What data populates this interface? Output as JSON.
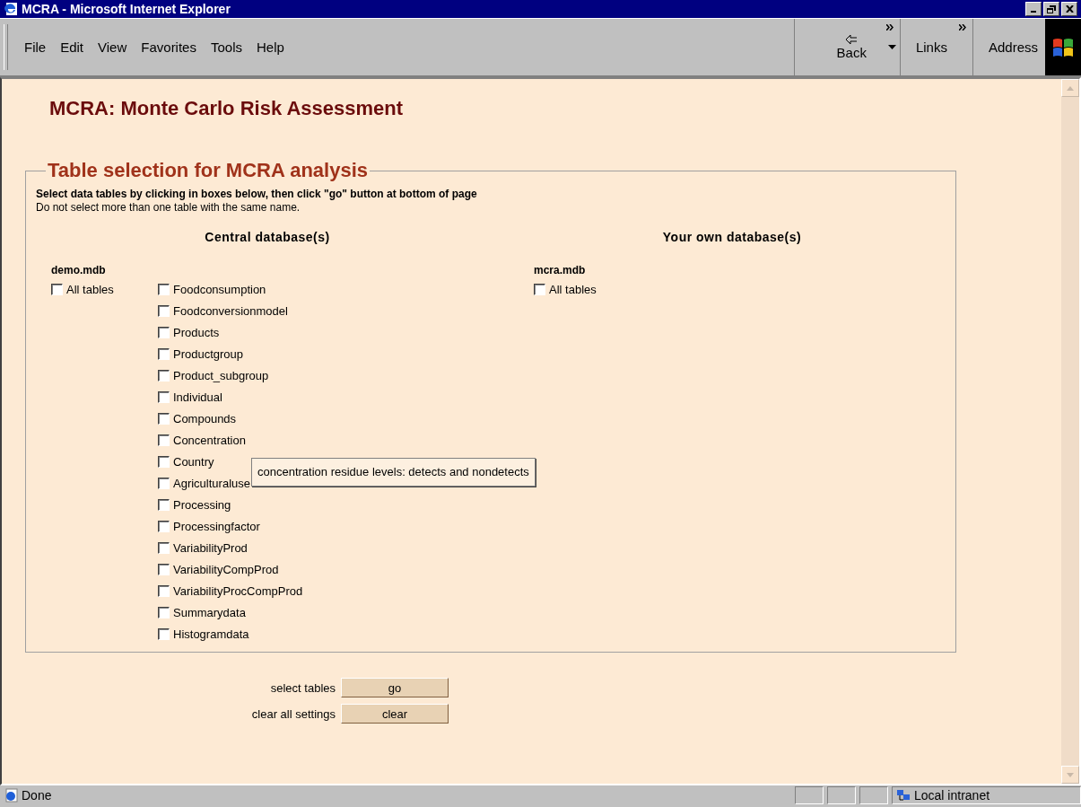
{
  "window": {
    "title": "MCRA - Microsoft Internet Explorer"
  },
  "menu": [
    "File",
    "Edit",
    "View",
    "Favorites",
    "Tools",
    "Help"
  ],
  "toolbar": {
    "back": "Back",
    "links": "Links",
    "address": "Address"
  },
  "page": {
    "heading": "MCRA: Monte Carlo Risk Assessment",
    "legend": "Table selection for MCRA analysis",
    "instruction": "Select data tables by clicking in boxes below, then click \"go\" button at bottom of page",
    "note": "Do not select more than one table with the same name.",
    "central_heading": "Central database(s)",
    "own_heading": "Your own database(s)",
    "databases": [
      {
        "name": "demo.mdb",
        "all": {
          "label": "All tables",
          "checked": false
        },
        "tables": [
          {
            "label": "Foodconsumption",
            "checked": false
          },
          {
            "label": "Foodconversionmodel",
            "checked": false
          },
          {
            "label": "Products",
            "checked": false
          },
          {
            "label": "Productgroup",
            "checked": false
          },
          {
            "label": "Product_subgroup",
            "checked": false
          },
          {
            "label": "Individual",
            "checked": false
          },
          {
            "label": "Compounds",
            "checked": false
          },
          {
            "label": "Concentration",
            "checked": false
          },
          {
            "label": "Country",
            "checked": false
          },
          {
            "label": "Agriculturaluse",
            "checked": false
          },
          {
            "label": "Processing",
            "checked": false
          },
          {
            "label": "Processingfactor",
            "checked": false
          },
          {
            "label": "VariabilityProd",
            "checked": false
          },
          {
            "label": "VariabilityCompProd",
            "checked": false
          },
          {
            "label": "VariabilityProcCompProd",
            "checked": false
          },
          {
            "label": "Summarydata",
            "checked": false
          },
          {
            "label": "Histogramdata",
            "checked": false
          }
        ]
      },
      {
        "name": "mcra.mdb",
        "all": {
          "label": "All tables",
          "checked": false
        }
      }
    ],
    "tooltip": "concentration residue levels: detects and nondetects",
    "actions": [
      {
        "label": "select tables",
        "button": "go"
      },
      {
        "label": "clear all settings",
        "button": "clear"
      }
    ]
  },
  "status": {
    "text": "Done",
    "zone": "Local intranet"
  }
}
